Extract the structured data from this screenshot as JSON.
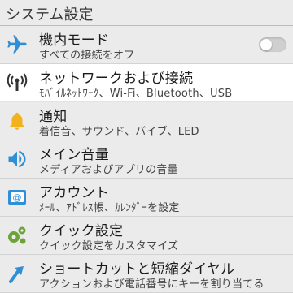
{
  "header": {
    "title": "システム設定"
  },
  "items": [
    {
      "title": "機内モード",
      "subtitle": "すべての接続をオフ",
      "icon": "airplane-icon",
      "toggle_on": false
    },
    {
      "title": "ネットワークおよび接続",
      "subtitle": "ﾓﾊﾞｲﾙﾈｯﾄﾜｰｸ、Wi-Fi、Bluetooth、USB",
      "icon": "antenna-icon"
    },
    {
      "title": "通知",
      "subtitle": "着信音、サウンド、バイブ、LED",
      "icon": "bell-icon"
    },
    {
      "title": "メイン音量",
      "subtitle": "メディアおよびアプリの音量",
      "icon": "speaker-icon"
    },
    {
      "title": "アカウント",
      "subtitle": "ﾒｰﾙ、ｱﾄﾞﾚｽ帳、ｶﾚﾝﾀﾞｰを設定",
      "icon": "account-icon"
    },
    {
      "title": "クイック設定",
      "subtitle": "クイック設定をカスタマイズ",
      "icon": "quick-settings-icon"
    },
    {
      "title": "ショートカットと短縮ダイヤル",
      "subtitle": "アクションおよび電話番号にキーを割り当てる",
      "icon": "shortcut-arrow-icon"
    }
  ],
  "colors": {
    "accent_blue": "#2f8fd6",
    "bell_yellow": "#f2b21b",
    "quick_green": "#6da43a",
    "background": "#ebebeb",
    "selected_row": "#ffffff"
  }
}
